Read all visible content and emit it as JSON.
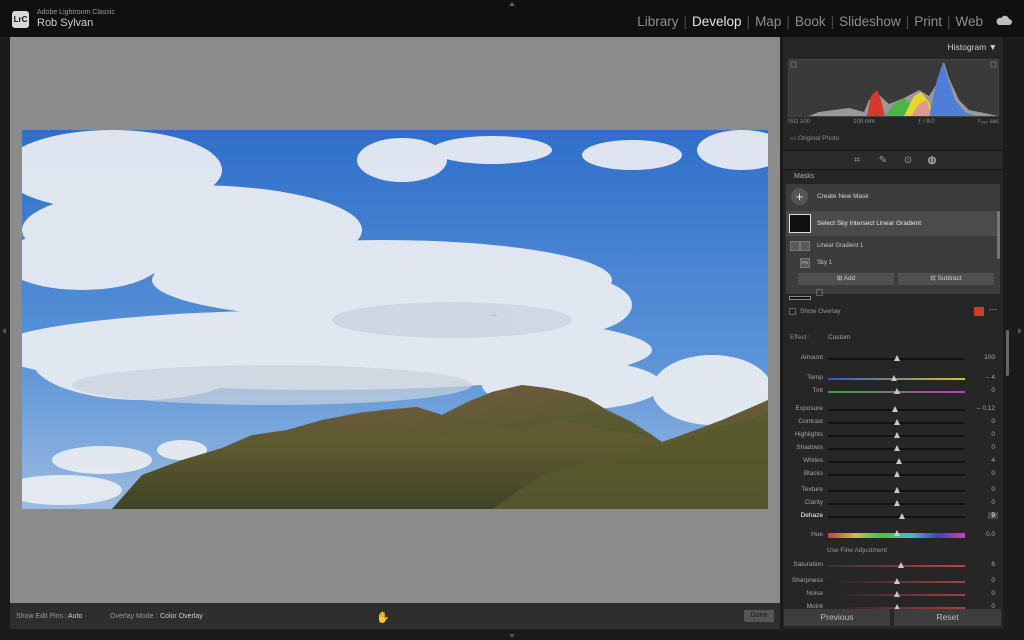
{
  "app": {
    "logo_text": "LrC",
    "name": "Adobe Lightroom Classic",
    "user": "Rob Sylvan"
  },
  "modules": [
    "Library",
    "Develop",
    "Map",
    "Book",
    "Slideshow",
    "Print",
    "Web"
  ],
  "active_module": "Develop",
  "icons": [
    "cloud-icon",
    "histogram-collapse-icon",
    "crop-icon",
    "healing-icon",
    "red-eye-icon",
    "masking-icon",
    "add-mask-icon",
    "hand-cursor-icon"
  ],
  "histogram": {
    "title": "Histogram",
    "iso": "ISO 100",
    "focal": "100 mm",
    "aperture": "ƒ / 8.0",
    "shutter": "¹⁄₂₅₀ sec",
    "original_photo": "Original Photo"
  },
  "masks": {
    "title": "Masks",
    "create_new": "Create New Mask",
    "mask_name": "Select Sky Intersect Linear Gradient",
    "components": [
      "Linear Gradient 1",
      "Sky 1"
    ],
    "add_label": "Add",
    "subtract_label": "Subtract",
    "show_overlay": "Show Overlay",
    "overlay_color": "#d6372f"
  },
  "effect": {
    "label": "Effect :",
    "value": "Custom"
  },
  "sliders": [
    {
      "label": "Amount",
      "value": "100",
      "pos": 0.5
    },
    {
      "label": "Temp",
      "value": "– 4",
      "pos": 0.48
    },
    {
      "label": "Tint",
      "value": "0",
      "pos": 0.5
    },
    {
      "label": "Exposure",
      "value": "– 0.12",
      "pos": 0.49
    },
    {
      "label": "Contrast",
      "value": "0",
      "pos": 0.5
    },
    {
      "label": "Highlights",
      "value": "0",
      "pos": 0.5
    },
    {
      "label": "Shadows",
      "value": "0",
      "pos": 0.5
    },
    {
      "label": "Whites",
      "value": "4",
      "pos": 0.52
    },
    {
      "label": "Blacks",
      "value": "0",
      "pos": 0.5
    },
    {
      "label": "Texture",
      "value": "0",
      "pos": 0.5
    },
    {
      "label": "Clarity",
      "value": "0",
      "pos": 0.5
    },
    {
      "label": "Dehaze",
      "value": "9",
      "pos": 0.54
    },
    {
      "label": "Hue",
      "value": "0.0",
      "pos": 0.5
    },
    {
      "label": "Saturation",
      "value": "6",
      "pos": 0.53
    },
    {
      "label": "Sharpness",
      "value": "0",
      "pos": 0.5
    },
    {
      "label": "Noise",
      "value": "0",
      "pos": 0.5
    },
    {
      "label": "Moiré",
      "value": "0",
      "pos": 0.5
    }
  ],
  "fine_adjustment": "Use Fine Adjustment",
  "toolbar": {
    "edit_pins_label": "Show Edit Pins :",
    "edit_pins_value": "Auto",
    "overlay_mode_label": "Overlay Mode :",
    "overlay_mode_value": "Color Overlay",
    "done": "Done"
  },
  "footer": {
    "previous": "Previous",
    "reset": "Reset"
  }
}
